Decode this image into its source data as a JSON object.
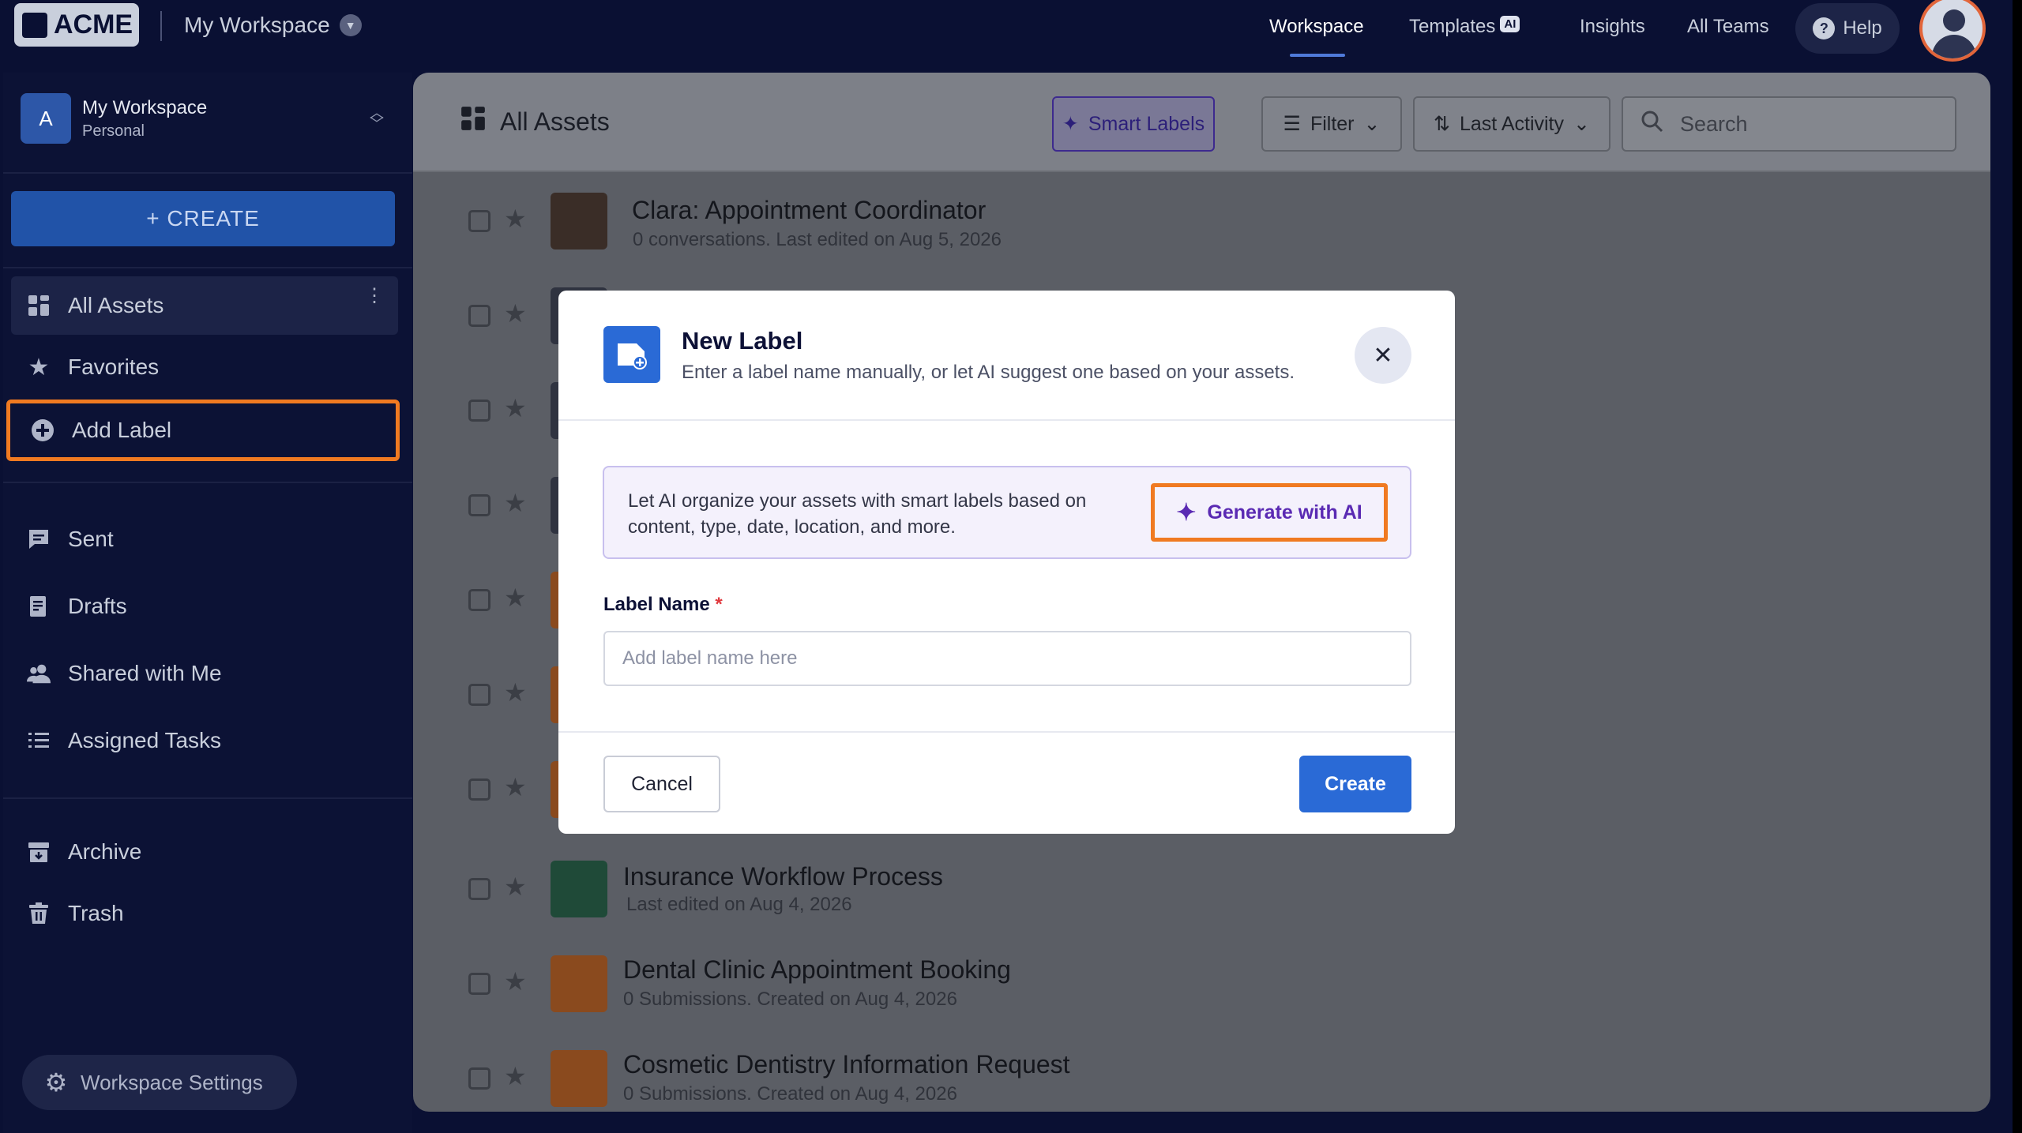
{
  "topbar": {
    "logo": "ACME",
    "workspace": "My Workspace",
    "nav": [
      {
        "label": "Workspace"
      },
      {
        "label": "Templates",
        "badge": "AI"
      },
      {
        "label": "Insights"
      },
      {
        "label": "All Teams"
      }
    ],
    "help": "Help"
  },
  "sidebar": {
    "workspace_badge": "A",
    "workspace_name": "My Workspace",
    "workspace_type": "Personal",
    "create_label": "+ CREATE",
    "items": [
      {
        "label": "All Assets"
      },
      {
        "label": "Favorites"
      },
      {
        "label": "Add Label"
      },
      {
        "label": "Sent"
      },
      {
        "label": "Drafts"
      },
      {
        "label": "Shared with Me"
      },
      {
        "label": "Assigned Tasks"
      },
      {
        "label": "Archive"
      },
      {
        "label": "Trash"
      }
    ],
    "settings_label": "Workspace Settings"
  },
  "main": {
    "title": "All Assets",
    "smart_labels": "Smart Labels",
    "filter": "Filter",
    "sort": "Last Activity",
    "search_placeholder": "Search",
    "rows": [
      {
        "title": "Clara: Appointment Coordinator",
        "sub": "0 conversations. Last edited on Aug 5, 2026"
      },
      {
        "title": "",
        "sub": ""
      },
      {
        "title": "",
        "sub": ""
      },
      {
        "title": "",
        "sub": ""
      },
      {
        "title": "",
        "sub": ""
      },
      {
        "title": "",
        "sub": ""
      },
      {
        "title": "",
        "sub": ""
      },
      {
        "title": "Insurance Workflow Process",
        "sub": "Last edited on Aug 4, 2026"
      },
      {
        "title": "Dental Clinic Appointment Booking",
        "sub": "0 Submissions. Created on Aug 4, 2026"
      },
      {
        "title": "Cosmetic Dentistry Information Request",
        "sub": "0 Submissions. Created on Aug 4, 2026"
      }
    ]
  },
  "modal": {
    "title": "New Label",
    "subtitle": "Enter a label name manually, or let AI suggest one based on your assets.",
    "ai_text": "Let AI organize your assets with smart labels based on content, type, date, location, and more.",
    "generate_label": "Generate with AI",
    "field_label": "Label Name",
    "required_mark": "*",
    "field_placeholder": "Add label name here",
    "field_value": "",
    "cancel": "Cancel",
    "create": "Create"
  },
  "colors": {
    "accent": "#2a6ad6",
    "highlight": "#f07a21",
    "ai_purple": "#5a2ab3",
    "sidebar_bg": "#0c1235"
  }
}
